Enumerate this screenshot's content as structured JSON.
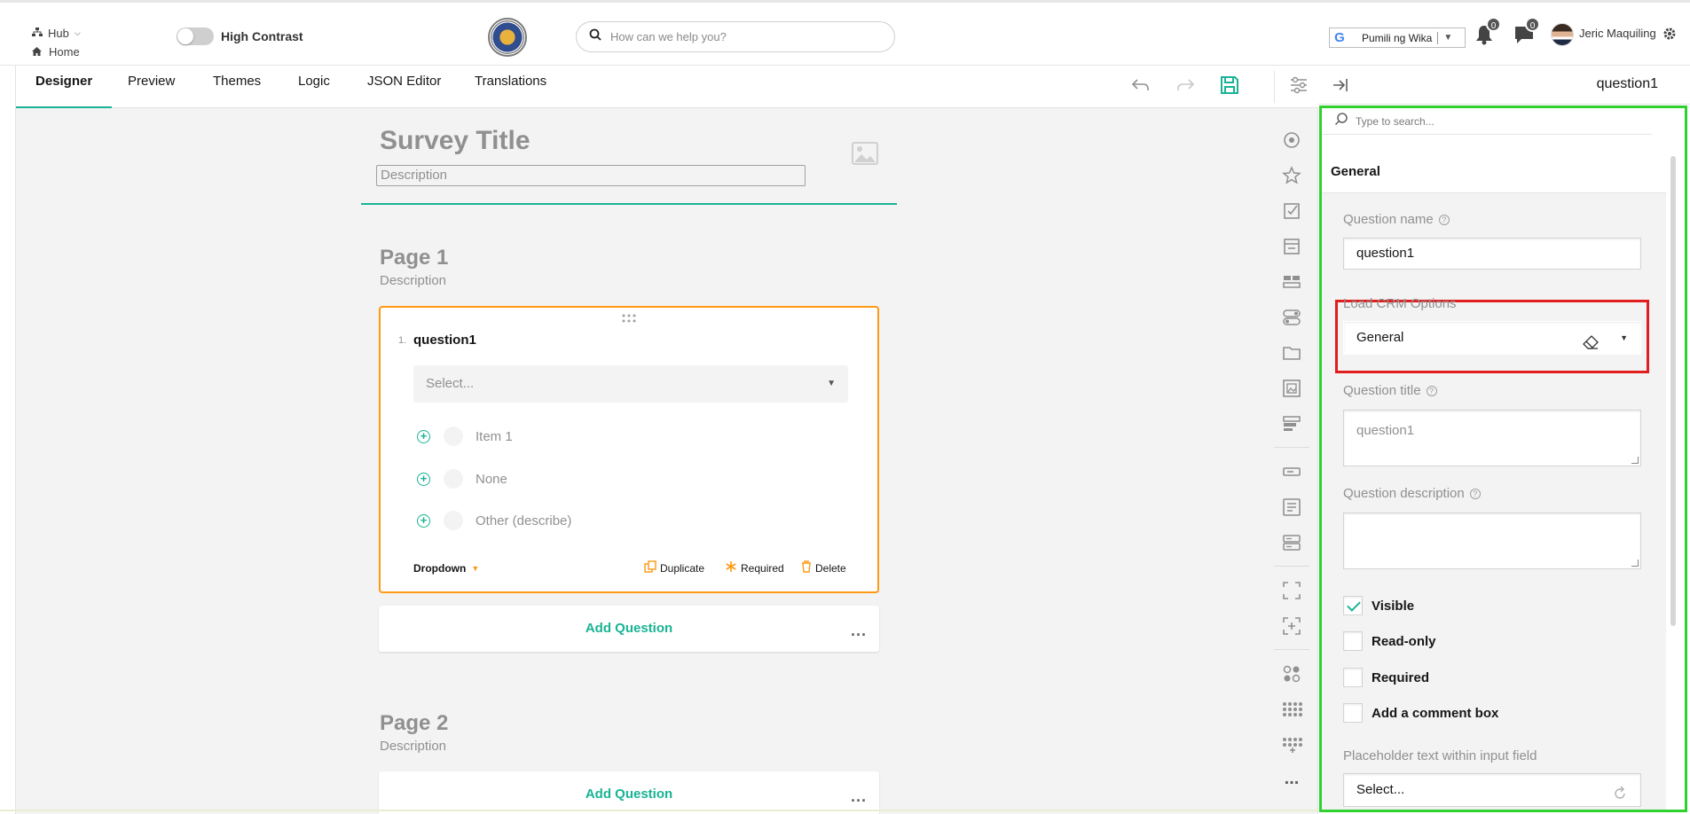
{
  "header": {
    "hub_label": "Hub",
    "home_label": "Home",
    "high_contrast_label": "High Contrast",
    "search_placeholder": "How can we help you?",
    "language_label": "Pumili ng Wika",
    "notifications_count": "0",
    "messages_count": "0",
    "user_name": "Jeric Maquiling"
  },
  "tabs": {
    "designer": "Designer",
    "preview": "Preview",
    "themes": "Themes",
    "logic": "Logic",
    "json_editor": "JSON Editor",
    "translations": "Translations",
    "active": "Designer"
  },
  "survey": {
    "title": "Survey Title",
    "description": "Description"
  },
  "page1": {
    "title": "Page 1",
    "description": "Description",
    "question": {
      "number": "1.",
      "title": "question1",
      "select_placeholder": "Select...",
      "choices": [
        "Item 1",
        "None",
        "Other (describe)"
      ],
      "type_label": "Dropdown",
      "actions": {
        "duplicate": "Duplicate",
        "required": "Required",
        "delete": "Delete"
      }
    },
    "add_question": "Add Question",
    "more": "..."
  },
  "page2": {
    "title": "Page 2",
    "description": "Description",
    "add_question": "Add Question",
    "more": "..."
  },
  "toolbox": {
    "more": "..."
  },
  "property_panel": {
    "selected_element": "question1",
    "search_placeholder": "Type to search...",
    "category": "General",
    "question_name_label": "Question name",
    "question_name_value": "question1",
    "load_crm_label": "Load CRM Options",
    "load_crm_value": "General",
    "question_title_label": "Question title",
    "question_title_placeholder": "question1",
    "question_description_label": "Question description",
    "question_description_value": "",
    "checkboxes": [
      {
        "label": "Visible",
        "checked": true
      },
      {
        "label": "Read-only",
        "checked": false
      },
      {
        "label": "Required",
        "checked": false
      },
      {
        "label": "Add a comment box",
        "checked": false
      }
    ],
    "placeholder_label": "Placeholder text within input field",
    "placeholder_value": "Select..."
  },
  "colors": {
    "accent": "#19b394",
    "selection": "#ff9814",
    "highlight_green": "#2fd12f",
    "highlight_red": "#e11d1d",
    "muted_text": "#909090"
  }
}
